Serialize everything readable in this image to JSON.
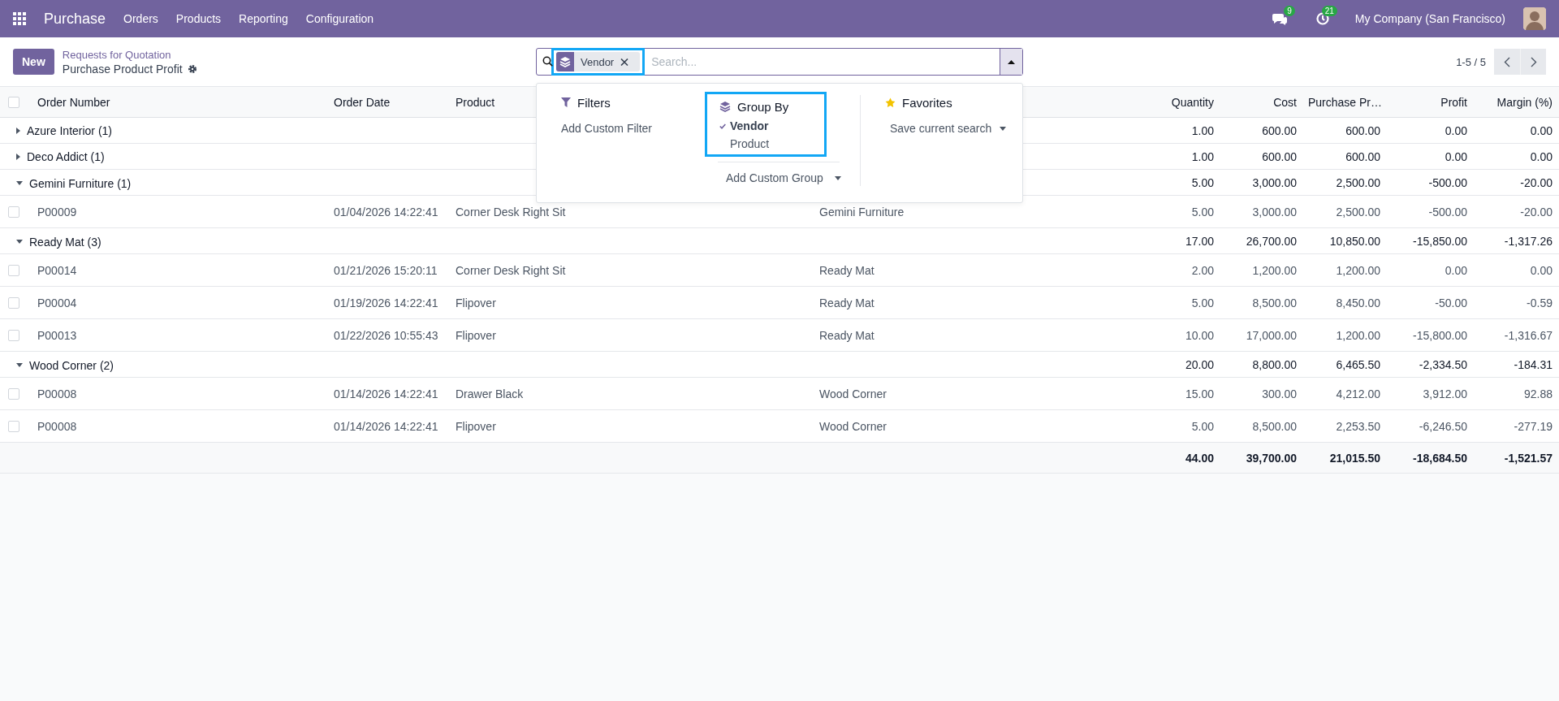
{
  "navbar": {
    "app": "Purchase",
    "menu": [
      "Orders",
      "Products",
      "Reporting",
      "Configuration"
    ],
    "messages_badge": "9",
    "activity_badge": "21",
    "company": "My Company (San Francisco)"
  },
  "control_panel": {
    "new_button": "New",
    "breadcrumb": "Requests for Quotation",
    "title": "Purchase Product Profit",
    "search": {
      "facets": [
        {
          "label": "Vendor",
          "highlighted": true
        }
      ],
      "placeholder": "Search..."
    },
    "pager": "1-5 / 5"
  },
  "search_panel": {
    "filters": {
      "title": "Filters",
      "items": [
        "Add Custom Filter"
      ]
    },
    "group_by": {
      "title": "Group By",
      "highlighted": true,
      "options": [
        {
          "label": "Vendor",
          "selected": true
        },
        {
          "label": "Product",
          "selected": false
        }
      ],
      "add_custom": "Add Custom Group"
    },
    "favorites": {
      "title": "Favorites",
      "items": [
        "Save current search"
      ]
    }
  },
  "table": {
    "select_all_checked": false,
    "text_columns": [
      "Order Number",
      "Order Date",
      "Product"
    ],
    "number_columns": [
      "Quantity",
      "Cost",
      "Purchase Pr…",
      "Profit",
      "Margin (%)"
    ],
    "rows": [
      {
        "kind": "group",
        "label": "Azure Interior (1)",
        "expanded": false,
        "values": [
          "1.00",
          "600.00",
          "600.00",
          "0.00",
          "0.00"
        ]
      },
      {
        "kind": "group",
        "label": "Deco Addict (1)",
        "expanded": false,
        "values": [
          "1.00",
          "600.00",
          "600.00",
          "0.00",
          "0.00"
        ]
      },
      {
        "kind": "group",
        "label": "Gemini Furniture (1)",
        "expanded": true,
        "values": [
          "5.00",
          "3,000.00",
          "2,500.00",
          "-500.00",
          "-20.00"
        ]
      },
      {
        "kind": "record",
        "checked": false,
        "cells": [
          "P00009",
          "01/04/2026 14:22:41",
          "Corner Desk Right Sit",
          "Gemini Furniture",
          "5.00",
          "3,000.00",
          "2,500.00",
          "-500.00",
          "-20.00"
        ]
      },
      {
        "kind": "group",
        "label": "Ready Mat (3)",
        "expanded": true,
        "values": [
          "17.00",
          "26,700.00",
          "10,850.00",
          "-15,850.00",
          "-1,317.26"
        ]
      },
      {
        "kind": "record",
        "checked": false,
        "cells": [
          "P00014",
          "01/21/2026 15:20:11",
          "Corner Desk Right Sit",
          "Ready Mat",
          "2.00",
          "1,200.00",
          "1,200.00",
          "0.00",
          "0.00"
        ]
      },
      {
        "kind": "record",
        "checked": false,
        "cells": [
          "P00004",
          "01/19/2026 14:22:41",
          "Flipover",
          "Ready Mat",
          "5.00",
          "8,500.00",
          "8,450.00",
          "-50.00",
          "-0.59"
        ]
      },
      {
        "kind": "record",
        "checked": false,
        "cells": [
          "P00013",
          "01/22/2026 10:55:43",
          "Flipover",
          "Ready Mat",
          "10.00",
          "17,000.00",
          "1,200.00",
          "-15,800.00",
          "-1,316.67"
        ]
      },
      {
        "kind": "group",
        "label": "Wood Corner (2)",
        "expanded": true,
        "values": [
          "20.00",
          "8,800.00",
          "6,465.50",
          "-2,334.50",
          "-184.31"
        ]
      },
      {
        "kind": "record",
        "checked": false,
        "cells": [
          "P00008",
          "01/14/2026 14:22:41",
          "Drawer Black",
          "Wood Corner",
          "15.00",
          "300.00",
          "4,212.00",
          "3,912.00",
          "92.88"
        ]
      },
      {
        "kind": "record",
        "checked": false,
        "cells": [
          "P00008",
          "01/14/2026 14:22:41",
          "Flipover",
          "Wood Corner",
          "5.00",
          "8,500.00",
          "2,253.50",
          "-6,246.50",
          "-277.19"
        ]
      }
    ],
    "totals": [
      "44.00",
      "39,700.00",
      "21,015.50",
      "-18,684.50",
      "-1,521.57"
    ]
  }
}
